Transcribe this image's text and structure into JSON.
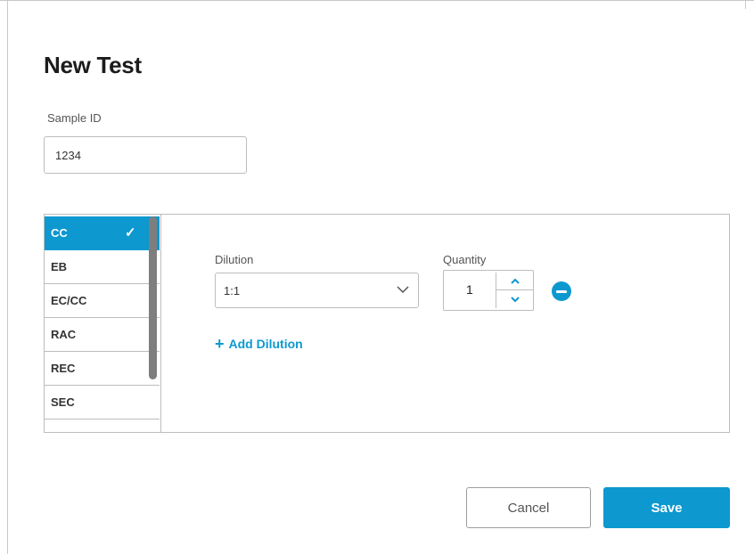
{
  "dialog": {
    "title": "New Test"
  },
  "sample": {
    "label": "Sample ID",
    "value": "1234"
  },
  "tests": {
    "items": [
      {
        "label": "CC",
        "selected": true
      },
      {
        "label": "EB",
        "selected": false
      },
      {
        "label": "EC/CC",
        "selected": false
      },
      {
        "label": "RAC",
        "selected": false
      },
      {
        "label": "REC",
        "selected": false
      },
      {
        "label": "SEC",
        "selected": false
      }
    ],
    "selected_icon": "✓"
  },
  "dilution": {
    "label": "Dilution",
    "value": "1:1"
  },
  "quantity": {
    "label": "Quantity",
    "value": "1"
  },
  "actions": {
    "add_dilution_icon": "+",
    "add_dilution_label": "Add Dilution",
    "cancel_label": "Cancel",
    "save_label": "Save"
  },
  "colors": {
    "accent": "#0d98cf",
    "border": "#bdbdbd"
  }
}
